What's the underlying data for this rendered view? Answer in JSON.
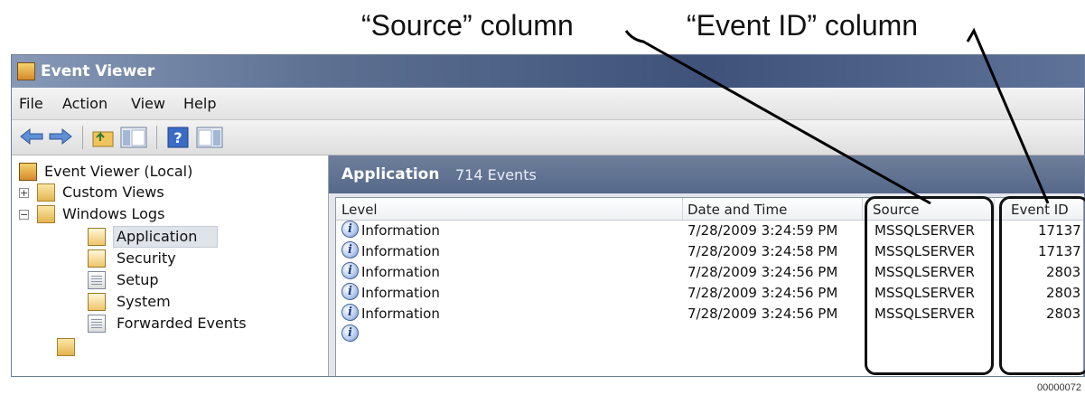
{
  "callouts": {
    "source_label": "“Source” column",
    "eventid_label": "“Event ID” column"
  },
  "window": {
    "title": "Event Viewer",
    "menu": [
      "File",
      "Action",
      "View",
      "Help"
    ],
    "toolbar_icons": [
      "back-arrow-icon",
      "forward-arrow-icon",
      "up-folder-icon",
      "show-hide-console-tree-icon",
      "help-icon",
      "show-hide-action-pane-icon"
    ]
  },
  "tree": {
    "root": "Event Viewer (Local)",
    "custom_views": "Custom Views",
    "windows_logs": "Windows Logs",
    "logs": [
      "Application",
      "Security",
      "Setup",
      "System",
      "Forwarded Events"
    ],
    "selected": "Application"
  },
  "log_panel": {
    "name": "Application",
    "count": "714 Events"
  },
  "grid": {
    "columns": [
      "Level",
      "Date and Time",
      "Source",
      "Event ID"
    ],
    "rows": [
      {
        "level": "Information",
        "date": "7/28/2009 3:24:59 PM",
        "source": "MSSQLSERVER",
        "event_id": "17137"
      },
      {
        "level": "Information",
        "date": "7/28/2009 3:24:58 PM",
        "source": "MSSQLSERVER",
        "event_id": "17137"
      },
      {
        "level": "Information",
        "date": "7/28/2009 3:24:56 PM",
        "source": "MSSQLSERVER",
        "event_id": "2803"
      },
      {
        "level": "Information",
        "date": "7/28/2009 3:24:56 PM",
        "source": "MSSQLSERVER",
        "event_id": "2803"
      },
      {
        "level": "Information",
        "date": "7/28/2009 3:24:56 PM",
        "source": "MSSQLSERVER",
        "event_id": "2803"
      }
    ]
  },
  "colors": {
    "title_bar": "#3e527a",
    "log_header": "#5c6f8f",
    "highlight_border": "#111111"
  },
  "figure_id": "00000072"
}
